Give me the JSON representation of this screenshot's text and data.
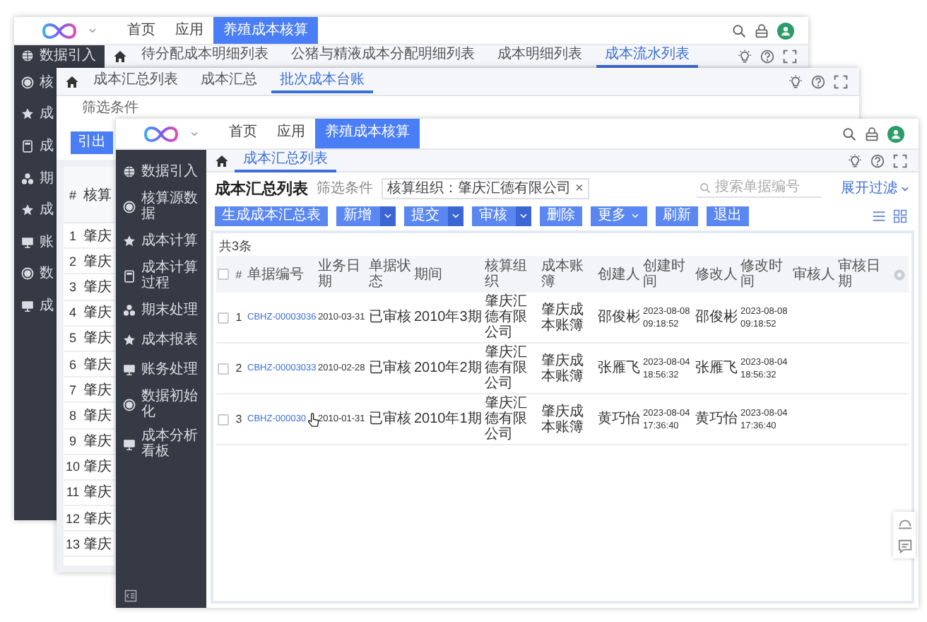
{
  "windows": [
    {
      "kind": "back",
      "menu": [
        {
          "label": "首页",
          "selected": false
        },
        {
          "label": "应用",
          "selected": false
        },
        {
          "label": "养殖成本核算",
          "selected": true
        }
      ],
      "sidebar": [
        {
          "label": "数据引入"
        },
        {
          "label": "核"
        },
        {
          "label": "成"
        },
        {
          "label": "成"
        },
        {
          "label": "期"
        },
        {
          "label": "成"
        },
        {
          "label": "账"
        },
        {
          "label": "数"
        },
        {
          "label": "成"
        }
      ],
      "tabs": [
        {
          "label": "待分配成本明细列表",
          "selected": false
        },
        {
          "label": "公猪与精液成本分配明细列表",
          "selected": false
        },
        {
          "label": "成本明细列表",
          "selected": false
        },
        {
          "label": "成本流水列表",
          "selected": true
        }
      ]
    },
    {
      "kind": "middle",
      "tabs": [
        {
          "label": "成本汇总列表",
          "selected": false
        },
        {
          "label": "成本汇总",
          "selected": false
        },
        {
          "label": "批次成本台账",
          "selected": true
        }
      ],
      "filter_label": "筛选条件",
      "export_button": "引出",
      "table": {
        "columns": [
          "#",
          "核算"
        ],
        "rows": [
          [
            "1",
            "肇庆"
          ],
          [
            "2",
            "肇庆"
          ],
          [
            "3",
            "肇庆"
          ],
          [
            "4",
            "肇庆"
          ],
          [
            "5",
            "肇庆"
          ],
          [
            "6",
            "肇庆"
          ],
          [
            "7",
            "肇庆"
          ],
          [
            "8",
            "肇庆"
          ],
          [
            "9",
            "肇庆"
          ],
          [
            "10",
            "肇庆"
          ],
          [
            "11",
            "肇庆"
          ],
          [
            "12",
            "肇庆"
          ],
          [
            "13",
            "肇庆"
          ]
        ]
      }
    },
    {
      "kind": "front",
      "menu": [
        {
          "label": "首页",
          "selected": false
        },
        {
          "label": "应用",
          "selected": false
        },
        {
          "label": "养殖成本核算",
          "selected": true
        }
      ],
      "sidebar": [
        {
          "label": "数据引入"
        },
        {
          "label": "核算源数据"
        },
        {
          "label": "成本计算"
        },
        {
          "label": "成本计算过程"
        },
        {
          "label": "期末处理"
        },
        {
          "label": "成本报表"
        },
        {
          "label": "账务处理"
        },
        {
          "label": "数据初始化"
        },
        {
          "label": "成本分析看板"
        }
      ],
      "tabs": [
        {
          "label": "成本汇总列表",
          "selected": true
        }
      ],
      "title": "成本汇总列表",
      "filter_label": "筛选条件",
      "filter_tag": {
        "label": "核算组织：肇庆汇德有限公司",
        "close": "×"
      },
      "search": {
        "placeholder": "搜索单据编号"
      },
      "expand_filter": "展开过滤",
      "buttons": [
        {
          "label": "生成成本汇总表",
          "kind": "plain"
        },
        {
          "label": "新增",
          "kind": "split"
        },
        {
          "label": "提交",
          "kind": "split"
        },
        {
          "label": "审核",
          "kind": "split"
        },
        {
          "label": "删除",
          "kind": "plain"
        },
        {
          "label": "更多",
          "kind": "dropdown"
        },
        {
          "label": "刷新",
          "kind": "plain"
        },
        {
          "label": "退出",
          "kind": "plain"
        }
      ],
      "table": {
        "count": "共3条",
        "select_all": {
          "checked": false
        },
        "columns": [
          {
            "label": "#",
            "kind": "index"
          },
          {
            "label": "单据编号",
            "kind": "link"
          },
          {
            "label": "业务日期",
            "kind": "date"
          },
          {
            "label": "单据状态",
            "kind": "status"
          },
          {
            "label": "期间",
            "kind": "period"
          },
          {
            "label": "核算组织",
            "kind": "text"
          },
          {
            "label": "成本账簿",
            "kind": "text"
          },
          {
            "label": "创建人",
            "kind": "person"
          },
          {
            "label": "创建时间",
            "kind": "datetime"
          },
          {
            "label": "修改人",
            "kind": "person"
          },
          {
            "label": "修改时间",
            "kind": "datetime"
          },
          {
            "label": "审核人",
            "kind": "person"
          },
          {
            "label": "审核日期",
            "kind": "date"
          }
        ],
        "rows": [
          {
            "checked": false,
            "hovered": false,
            "cells": [
              "1",
              "CBHZ-00003036",
              "2010-03-31",
              "已审核",
              "2010年3期",
              "肇庆汇德有限公司",
              "肇庆成本账簿",
              "邵俊彬",
              "2023-08-08 09:18:52",
              "邵俊彬",
              "2023-08-08 09:18:52"
            ]
          },
          {
            "checked": false,
            "hovered": false,
            "cells": [
              "2",
              "CBHZ-00003033",
              "2010-02-28",
              "已审核",
              "2010年2期",
              "肇庆汇德有限公司",
              "肇庆成本账簿",
              "张雁飞",
              "2023-08-04 18:56:32",
              "张雁飞",
              "2023-08-04 18:56:32"
            ]
          },
          {
            "checked": false,
            "hovered": true,
            "cells": [
              "3",
              "CBHZ-000030",
              "2010-01-31",
              "已审核",
              "2010年1期",
              "肇庆汇德有限公司",
              "肇庆成本账簿",
              "黄巧怡",
              "2023-08-04 17:36:40",
              "黄巧怡",
              "2023-08-04 17:36:40"
            ]
          }
        ]
      }
    }
  ]
}
